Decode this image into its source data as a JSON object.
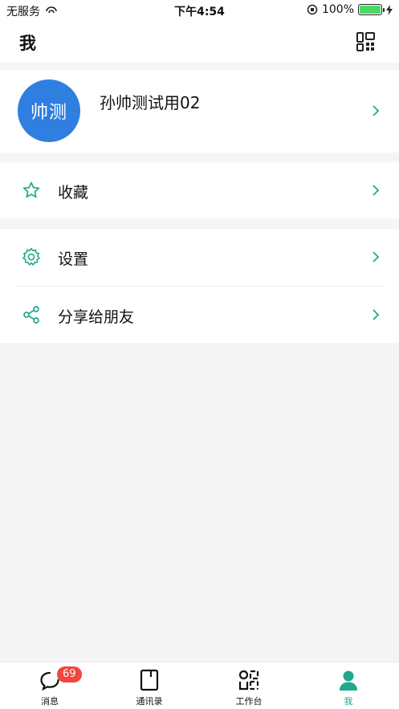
{
  "status_bar": {
    "carrier": "无服务",
    "time": "下午4:54",
    "battery": "100%"
  },
  "header": {
    "title": "我"
  },
  "profile": {
    "avatar_text": "帅测",
    "name": "孙帅测试用02"
  },
  "menu": {
    "favorites": "收藏",
    "settings": "设置",
    "share": "分享给朋友"
  },
  "tabbar": {
    "tabs": [
      {
        "label": "消息",
        "badge": "69"
      },
      {
        "label": "通讯录"
      },
      {
        "label": "工作台"
      },
      {
        "label": "我"
      }
    ]
  },
  "colors": {
    "accent": "#22a88d",
    "avatar": "#2f7fe0",
    "badge": "#f0463e"
  }
}
